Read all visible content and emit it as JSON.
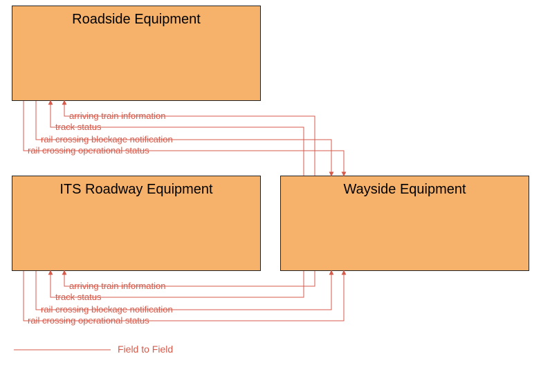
{
  "nodes": {
    "roadside": {
      "label": "Roadside Equipment"
    },
    "its": {
      "label": "ITS Roadway Equipment"
    },
    "wayside": {
      "label": "Wayside Equipment"
    }
  },
  "flows_top": [
    {
      "label": "arriving train information"
    },
    {
      "label": "track status"
    },
    {
      "label": "rail crossing blockage notification"
    },
    {
      "label": "rail crossing operational status"
    }
  ],
  "flows_bottom": [
    {
      "label": "arriving train information"
    },
    {
      "label": "track status"
    },
    {
      "label": "rail crossing blockage notification"
    },
    {
      "label": "rail crossing operational status"
    }
  ],
  "legend": {
    "label": "Field to Field"
  },
  "colors": {
    "node_fill": "#f6b26b",
    "line": "#d65a4a"
  }
}
